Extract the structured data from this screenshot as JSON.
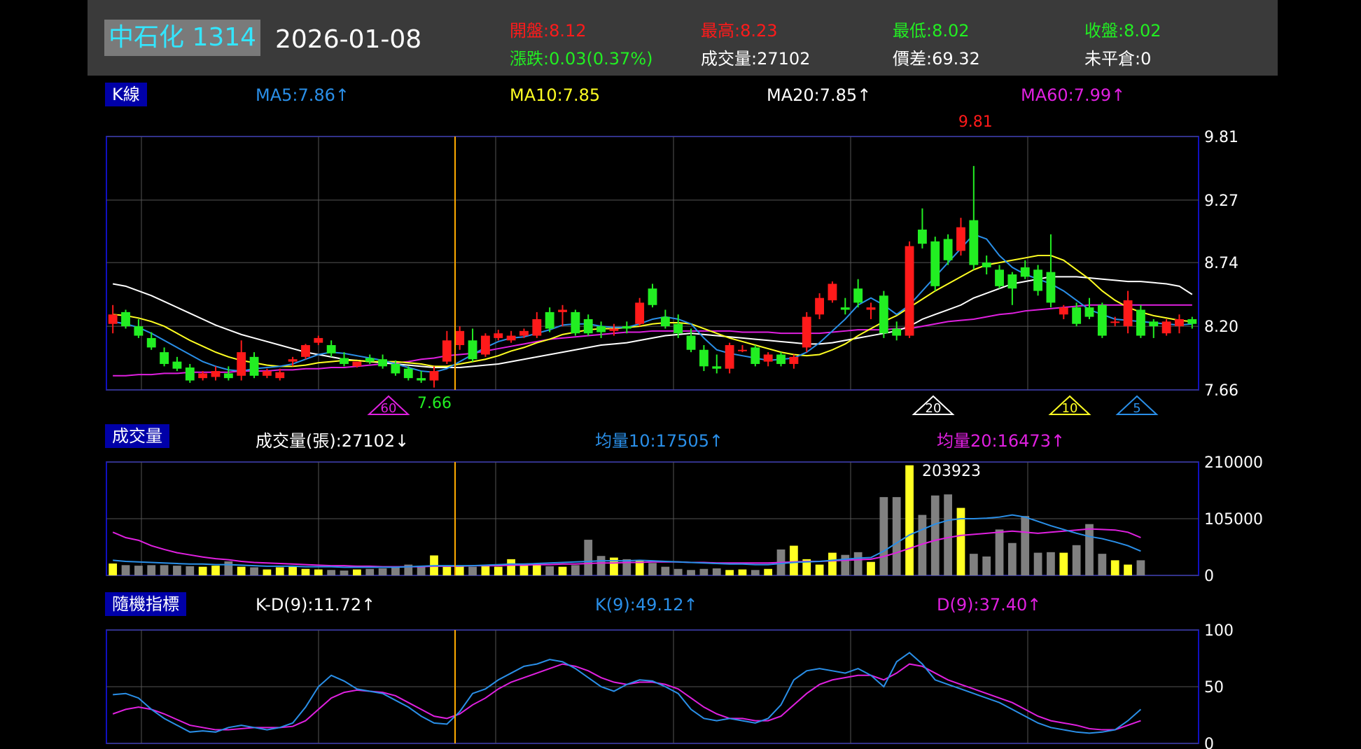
{
  "header": {
    "stock": "中石化 1314",
    "date": "2026-01-08",
    "open": "開盤:8.12",
    "high": "最高:8.23",
    "low": "最低:8.02",
    "close": "收盤:8.02",
    "change": "漲跌:0.03(0.37%)",
    "volume": "成交量:27102",
    "spread": "價差:69.32",
    "open_interest": "未平倉:0"
  },
  "colors": {
    "up": "#ff1a1a",
    "down": "#22ee22",
    "ma5": "#2a8fe8",
    "ma10": "#ffff22",
    "ma20": "#ffffff",
    "ma60": "#e020e0",
    "grid": "#555555",
    "frame": "#1010c0",
    "cursor": "#ffaa00",
    "volume_up": "#ffff22",
    "volume_down": "#808080"
  },
  "panels": {
    "kline": {
      "label": "K線",
      "ma5": "MA5:7.86↑",
      "ma10": "MA10:7.85",
      "ma20": "MA20:7.85↑",
      "ma60": "MA60:7.99↑"
    },
    "volume": {
      "label": "成交量",
      "vol": "成交量(張):27102↓",
      "avg10": "均量10:17505↑",
      "avg20": "均量20:16473↑"
    },
    "kd": {
      "label": "隨機指標",
      "kd_diff": "K-D(9):11.72↑",
      "k": "K(9):49.12↑",
      "d": "D(9):37.40↑"
    }
  },
  "chart_data": [
    {
      "type": "candlestick",
      "yticks": [
        "9.81",
        "9.27",
        "8.74",
        "8.20",
        "7.66"
      ],
      "ylim": [
        7.66,
        9.81
      ],
      "max_label": "9.81",
      "min_label": "7.66",
      "markers": [
        "60",
        "20",
        "10",
        "5"
      ],
      "candles": [
        [
          8.22,
          8.38,
          8.14,
          8.3
        ],
        [
          8.32,
          8.34,
          8.18,
          8.2
        ],
        [
          8.2,
          8.26,
          8.1,
          8.12
        ],
        [
          8.1,
          8.15,
          8.0,
          8.02
        ],
        [
          7.98,
          8.02,
          7.86,
          7.88
        ],
        [
          7.9,
          7.94,
          7.82,
          7.84
        ],
        [
          7.85,
          7.88,
          7.72,
          7.74
        ],
        [
          7.76,
          7.82,
          7.74,
          7.8
        ],
        [
          7.77,
          7.86,
          7.74,
          7.82
        ],
        [
          7.8,
          7.86,
          7.74,
          7.76
        ],
        [
          7.78,
          8.08,
          7.74,
          7.98
        ],
        [
          7.94,
          7.98,
          7.76,
          7.78
        ],
        [
          7.78,
          7.84,
          7.76,
          7.82
        ],
        [
          7.76,
          7.84,
          7.74,
          7.81
        ],
        [
          7.9,
          7.94,
          7.86,
          7.92
        ],
        [
          7.94,
          8.05,
          7.92,
          8.04
        ],
        [
          8.06,
          8.12,
          8.04,
          8.1
        ],
        [
          8.04,
          8.08,
          7.94,
          7.97
        ],
        [
          7.93,
          7.98,
          7.86,
          7.88
        ],
        [
          7.86,
          7.9,
          7.85,
          7.9
        ],
        [
          7.93,
          7.96,
          7.88,
          7.9
        ],
        [
          7.92,
          7.96,
          7.84,
          7.86
        ],
        [
          7.88,
          7.91,
          7.78,
          7.8
        ],
        [
          7.84,
          7.86,
          7.74,
          7.76
        ],
        [
          7.76,
          7.82,
          7.72,
          7.74
        ],
        [
          7.74,
          7.86,
          7.68,
          7.82
        ],
        [
          7.9,
          8.16,
          7.88,
          8.08
        ],
        [
          8.04,
          8.2,
          8.0,
          8.16
        ],
        [
          8.08,
          8.18,
          7.9,
          7.92
        ],
        [
          7.96,
          8.14,
          7.94,
          8.12
        ],
        [
          8.1,
          8.17,
          8.08,
          8.14
        ],
        [
          8.08,
          8.16,
          8.06,
          8.12
        ],
        [
          8.12,
          8.18,
          8.1,
          8.16
        ],
        [
          8.12,
          8.32,
          8.1,
          8.26
        ],
        [
          8.32,
          8.36,
          8.15,
          8.18
        ],
        [
          8.32,
          8.38,
          8.2,
          8.34
        ],
        [
          8.32,
          8.34,
          8.12,
          8.14
        ],
        [
          8.26,
          8.3,
          8.12,
          8.14
        ],
        [
          8.2,
          8.24,
          8.1,
          8.15
        ],
        [
          8.16,
          8.22,
          8.12,
          8.18
        ],
        [
          8.2,
          8.24,
          8.14,
          8.18
        ],
        [
          8.22,
          8.44,
          8.2,
          8.4
        ],
        [
          8.52,
          8.56,
          8.36,
          8.38
        ],
        [
          8.28,
          8.34,
          8.18,
          8.2
        ],
        [
          8.22,
          8.3,
          8.1,
          8.14
        ],
        [
          8.12,
          8.18,
          7.98,
          8.0
        ],
        [
          8.0,
          8.04,
          7.82,
          7.86
        ],
        [
          7.86,
          7.96,
          7.8,
          7.84
        ],
        [
          7.84,
          8.06,
          7.8,
          8.04
        ],
        [
          8.0,
          8.04,
          7.98,
          8.0
        ],
        [
          8.02,
          8.04,
          7.86,
          7.88
        ],
        [
          7.9,
          7.98,
          7.86,
          7.96
        ],
        [
          7.96,
          7.98,
          7.86,
          7.88
        ],
        [
          7.88,
          7.96,
          7.84,
          7.94
        ],
        [
          8.02,
          8.32,
          7.98,
          8.28
        ],
        [
          8.3,
          8.48,
          8.26,
          8.44
        ],
        [
          8.42,
          8.58,
          8.4,
          8.56
        ],
        [
          8.36,
          8.44,
          8.3,
          8.34
        ],
        [
          8.52,
          8.6,
          8.36,
          8.4
        ],
        [
          8.34,
          8.4,
          8.26,
          8.36
        ],
        [
          8.46,
          8.5,
          8.1,
          8.14
        ],
        [
          8.18,
          8.24,
          8.08,
          8.12
        ],
        [
          8.12,
          8.92,
          8.1,
          8.88
        ],
        [
          9.02,
          9.2,
          8.86,
          8.9
        ],
        [
          8.92,
          8.96,
          8.5,
          8.54
        ],
        [
          8.94,
          8.98,
          8.72,
          8.76
        ],
        [
          8.84,
          9.12,
          8.8,
          9.04
        ],
        [
          9.1,
          9.56,
          8.68,
          8.72
        ],
        [
          8.74,
          8.8,
          8.64,
          8.7
        ],
        [
          8.68,
          8.72,
          8.52,
          8.54
        ],
        [
          8.64,
          8.66,
          8.38,
          8.52
        ],
        [
          8.7,
          8.76,
          8.6,
          8.62
        ],
        [
          8.68,
          8.72,
          8.46,
          8.5
        ],
        [
          8.66,
          8.98,
          8.36,
          8.4
        ],
        [
          8.3,
          8.38,
          8.26,
          8.36
        ],
        [
          8.36,
          8.4,
          8.2,
          8.22
        ],
        [
          8.36,
          8.44,
          8.26,
          8.28
        ],
        [
          8.38,
          8.4,
          8.1,
          8.12
        ],
        [
          8.24,
          8.28,
          8.2,
          8.24
        ],
        [
          8.2,
          8.5,
          8.14,
          8.42
        ],
        [
          8.34,
          8.38,
          8.1,
          8.12
        ],
        [
          8.24,
          8.26,
          8.1,
          8.2
        ],
        [
          8.14,
          8.26,
          8.12,
          8.24
        ],
        [
          8.2,
          8.3,
          8.14,
          8.26
        ],
        [
          8.26,
          8.28,
          8.18,
          8.22
        ]
      ],
      "ma5": [
        8.24,
        8.22,
        8.19,
        8.14,
        8.08,
        8.02,
        7.96,
        7.9,
        7.86,
        7.83,
        7.82,
        7.84,
        7.85,
        7.86,
        7.88,
        7.92,
        7.96,
        7.98,
        7.97,
        7.95,
        7.93,
        7.91,
        7.88,
        7.85,
        7.82,
        7.81,
        7.84,
        7.9,
        7.96,
        8.02,
        8.07,
        8.1,
        8.11,
        8.14,
        8.17,
        8.21,
        8.22,
        8.22,
        8.2,
        8.19,
        8.19,
        8.22,
        8.26,
        8.28,
        8.26,
        8.22,
        8.1,
        8.0,
        7.97,
        7.95,
        7.93,
        7.91,
        7.92,
        7.93,
        7.98,
        8.06,
        8.16,
        8.26,
        8.38,
        8.44,
        8.38,
        8.3,
        8.38,
        8.5,
        8.62,
        8.74,
        8.86,
        8.98,
        8.94,
        8.8,
        8.7,
        8.64,
        8.6,
        8.56,
        8.5,
        8.42,
        8.34,
        8.3,
        8.26,
        8.25,
        8.24,
        8.23,
        8.22,
        8.21,
        8.22
      ],
      "ma10": [
        8.3,
        8.29,
        8.27,
        8.24,
        8.2,
        8.14,
        8.08,
        8.03,
        7.98,
        7.94,
        7.91,
        7.89,
        7.87,
        7.86,
        7.86,
        7.87,
        7.89,
        7.9,
        7.91,
        7.91,
        7.9,
        7.9,
        7.9,
        7.89,
        7.88,
        7.86,
        7.86,
        7.88,
        7.9,
        7.92,
        7.95,
        7.99,
        8.02,
        8.06,
        8.09,
        8.13,
        8.15,
        8.17,
        8.18,
        8.18,
        8.19,
        8.2,
        8.22,
        8.23,
        8.23,
        8.22,
        8.18,
        8.14,
        8.1,
        8.07,
        8.04,
        8.01,
        7.98,
        7.96,
        7.95,
        7.96,
        8.0,
        8.05,
        8.12,
        8.18,
        8.24,
        8.29,
        8.36,
        8.43,
        8.5,
        8.56,
        8.62,
        8.68,
        8.72,
        8.74,
        8.76,
        8.78,
        8.8,
        8.8,
        8.76,
        8.68,
        8.6,
        8.5,
        8.42,
        8.36,
        8.32,
        8.29,
        8.27,
        8.25,
        8.24
      ],
      "ma20": [
        8.56,
        8.54,
        8.5,
        8.46,
        8.41,
        8.36,
        8.31,
        8.26,
        8.21,
        8.17,
        8.13,
        8.1,
        8.07,
        8.04,
        8.01,
        7.98,
        7.96,
        7.94,
        7.92,
        7.91,
        7.9,
        7.89,
        7.88,
        7.87,
        7.86,
        7.85,
        7.85,
        7.85,
        7.86,
        7.87,
        7.88,
        7.9,
        7.92,
        7.94,
        7.96,
        7.98,
        8.0,
        8.02,
        8.04,
        8.05,
        8.06,
        8.08,
        8.1,
        8.12,
        8.13,
        8.14,
        8.13,
        8.12,
        8.11,
        8.1,
        8.09,
        8.08,
        8.07,
        8.06,
        8.05,
        8.05,
        8.06,
        8.08,
        8.1,
        8.12,
        8.14,
        8.16,
        8.2,
        8.26,
        8.3,
        8.34,
        8.38,
        8.44,
        8.48,
        8.52,
        8.56,
        8.58,
        8.6,
        8.62,
        8.62,
        8.62,
        8.61,
        8.6,
        8.59,
        8.58,
        8.58,
        8.57,
        8.56,
        8.54,
        8.47
      ],
      "ma60": [
        7.78,
        7.78,
        7.79,
        7.79,
        7.8,
        7.8,
        7.81,
        7.81,
        7.81,
        7.81,
        7.82,
        7.82,
        7.82,
        7.83,
        7.83,
        7.84,
        7.84,
        7.85,
        7.85,
        7.86,
        7.87,
        7.88,
        7.89,
        7.9,
        7.92,
        7.93,
        7.95,
        7.96,
        7.97,
        7.99,
        8.01,
        8.03,
        8.05,
        8.07,
        8.09,
        8.1,
        8.11,
        8.12,
        8.13,
        8.14,
        8.15,
        8.15,
        8.16,
        8.16,
        8.16,
        8.16,
        8.16,
        8.16,
        8.16,
        8.15,
        8.15,
        8.15,
        8.14,
        8.14,
        8.14,
        8.14,
        8.15,
        8.16,
        8.17,
        8.17,
        8.17,
        8.18,
        8.18,
        8.2,
        8.22,
        8.24,
        8.25,
        8.26,
        8.28,
        8.3,
        8.31,
        8.33,
        8.34,
        8.35,
        8.36,
        8.37,
        8.38,
        8.38,
        8.38,
        8.38,
        8.38,
        8.38,
        8.38,
        8.38,
        8.38
      ]
    },
    {
      "type": "bar",
      "yticks": [
        "210000",
        "105000",
        "0"
      ],
      "ylim": [
        0,
        210000
      ],
      "max_label": "203923",
      "volumes": [
        22000,
        19000,
        18000,
        19000,
        19000,
        18000,
        17000,
        16000,
        18000,
        26000,
        16000,
        15000,
        11000,
        15000,
        16000,
        12000,
        11000,
        10000,
        9000,
        11000,
        12000,
        13000,
        16000,
        20000,
        18000,
        37000,
        16000,
        17000,
        16000,
        18000,
        16000,
        30000,
        22000,
        21000,
        17000,
        16000,
        19000,
        66000,
        36000,
        33000,
        30000,
        28000,
        23000,
        16000,
        12000,
        10000,
        12000,
        13000,
        10000,
        11000,
        10000,
        12000,
        48000,
        55000,
        30000,
        20000,
        42000,
        38000,
        43000,
        25000,
        145000,
        145000,
        203923,
        112000,
        148000,
        150000,
        125000,
        40000,
        35000,
        85000,
        60000,
        110000,
        42000,
        43000,
        42000,
        56000,
        95000,
        40000,
        28000,
        20000,
        28000
      ],
      "avg10": [
        28000,
        26000,
        25000,
        24000,
        23000,
        22000,
        21000,
        21000,
        20000,
        20000,
        19000,
        18000,
        17000,
        17000,
        17000,
        16000,
        16000,
        16000,
        15000,
        15000,
        15000,
        15000,
        15000,
        16000,
        17000,
        18000,
        18000,
        18000,
        18000,
        19000,
        20000,
        21000,
        21000,
        22000,
        23000,
        24000,
        25000,
        26000,
        27000,
        27000,
        27000,
        28000,
        27000,
        26000,
        25000,
        24000,
        23000,
        22000,
        21000,
        21000,
        20000,
        20000,
        22000,
        24000,
        25000,
        26000,
        28000,
        30000,
        32000,
        33000,
        45000,
        60000,
        75000,
        85000,
        95000,
        102000,
        105000,
        105000,
        106000,
        108000,
        112000,
        108000,
        100000,
        92000,
        85000,
        78000,
        72000,
        68000,
        62000,
        55000,
        45000
      ],
      "avg20": [
        80000,
        70000,
        65000,
        55000,
        48000,
        42000,
        38000,
        34000,
        31000,
        29000,
        26000,
        24000,
        23000,
        22000,
        21000,
        20000,
        19000,
        18000,
        18000,
        17000,
        17000,
        16000,
        16000,
        16000,
        16000,
        17000,
        17000,
        17000,
        18000,
        18000,
        18000,
        19000,
        19000,
        20000,
        20000,
        21000,
        21000,
        22000,
        23000,
        23000,
        24000,
        24000,
        25000,
        25000,
        25000,
        24000,
        24000,
        23000,
        23000,
        23000,
        23000,
        23000,
        24000,
        25000,
        26000,
        26000,
        27000,
        28000,
        29000,
        30000,
        35000,
        42000,
        50000,
        58000,
        65000,
        70000,
        74000,
        76000,
        78000,
        80000,
        82000,
        80000,
        78000,
        80000,
        82000,
        84000,
        86000,
        85000,
        84000,
        80000,
        70000
      ]
    },
    {
      "type": "line",
      "yticks": [
        "100",
        "50",
        "0"
      ],
      "ylim": [
        0,
        100
      ],
      "k": [
        43,
        44,
        40,
        30,
        22,
        16,
        10,
        11,
        10,
        14,
        16,
        14,
        12,
        14,
        18,
        32,
        50,
        60,
        55,
        48,
        46,
        44,
        38,
        32,
        24,
        18,
        17,
        28,
        44,
        48,
        56,
        62,
        68,
        70,
        74,
        72,
        66,
        58,
        50,
        46,
        52,
        56,
        55,
        50,
        44,
        30,
        22,
        20,
        22,
        20,
        18,
        22,
        34,
        56,
        64,
        66,
        64,
        62,
        66,
        60,
        50,
        72,
        80,
        70,
        56,
        52,
        48,
        44,
        40,
        36,
        30,
        24,
        18,
        14,
        12,
        10,
        9,
        10,
        12,
        20,
        30
      ],
      "d": [
        26,
        30,
        32,
        30,
        26,
        21,
        16,
        14,
        12,
        12,
        13,
        14,
        14,
        14,
        15,
        20,
        30,
        40,
        45,
        47,
        46,
        45,
        42,
        36,
        30,
        24,
        22,
        26,
        34,
        40,
        48,
        54,
        58,
        62,
        66,
        70,
        68,
        64,
        58,
        54,
        52,
        54,
        54,
        52,
        48,
        40,
        32,
        26,
        22,
        22,
        20,
        20,
        24,
        34,
        44,
        52,
        56,
        58,
        60,
        60,
        56,
        62,
        70,
        68,
        62,
        56,
        52,
        48,
        44,
        40,
        36,
        30,
        24,
        20,
        18,
        16,
        13,
        12,
        12,
        16,
        20
      ]
    }
  ]
}
